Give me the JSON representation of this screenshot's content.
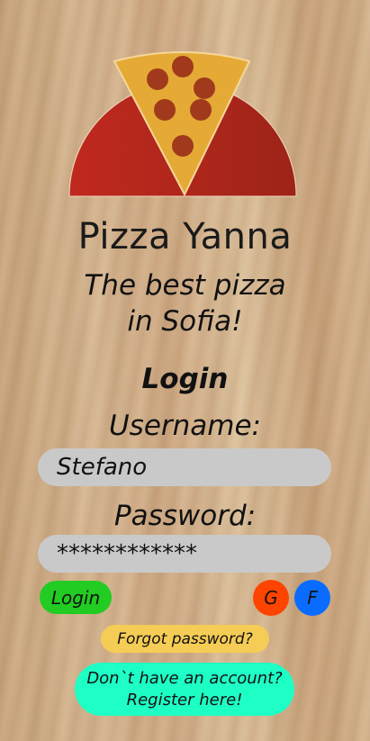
{
  "brand": {
    "name": "Pizza Yanna",
    "tagline_line1": "The best pizza",
    "tagline_line2": "in Sofia!"
  },
  "logo": {
    "icon": "pizza-slice-logo-icon",
    "colors": {
      "dome": "#b8281e",
      "crust": "#e8a836",
      "pepperoni": "#a53a1c"
    }
  },
  "form": {
    "title": "Login",
    "username_label": "Username:",
    "username_value": "Stefano",
    "password_label": "Password:",
    "password_value": "************"
  },
  "buttons": {
    "login": "Login",
    "google": "G",
    "facebook": "F",
    "forgot": "Forgot password?",
    "register_line1": "Don`t have an account?",
    "register_line2": "Register here!"
  },
  "colors": {
    "login_button": "#22cc22",
    "google_button": "#ff4400",
    "facebook_button": "#0a6cff",
    "forgot_button": "#f5cc55",
    "register_button": "#1effc6",
    "input_background": "#c9c9c9"
  }
}
